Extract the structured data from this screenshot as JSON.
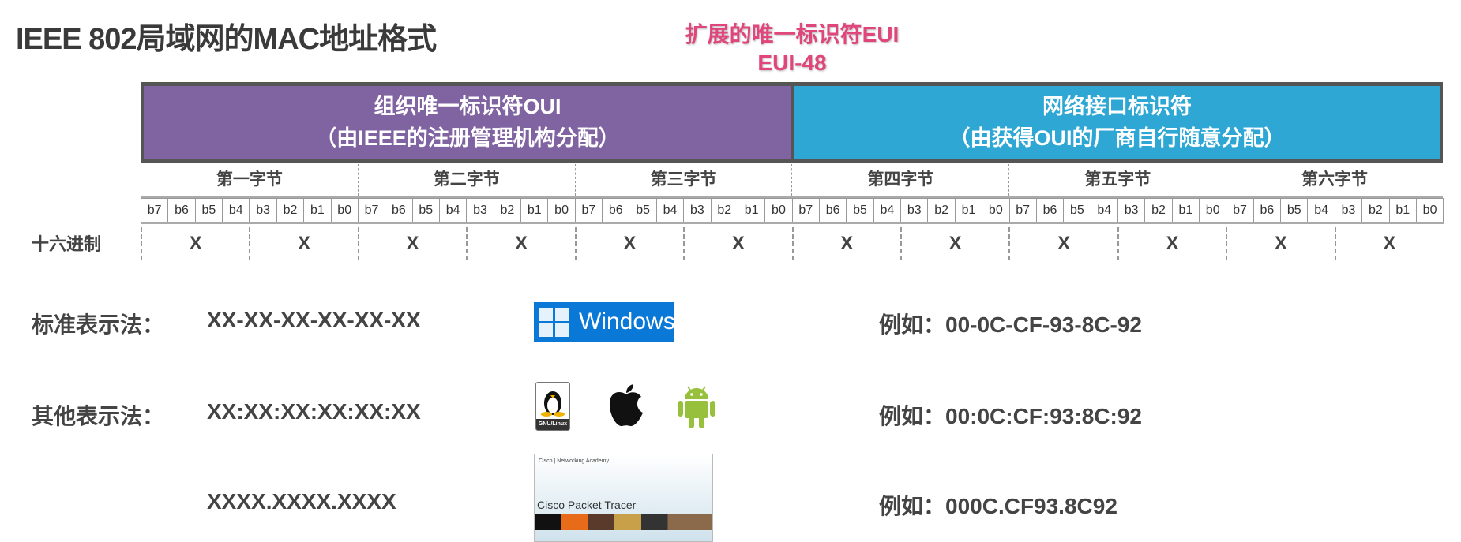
{
  "title": "IEEE 802局域网的MAC地址格式",
  "eui": {
    "line1": "扩展的唯一标识符EUI",
    "line2": "EUI-48"
  },
  "oui": {
    "line1": "组织唯一标识符OUI",
    "line2": "（由IEEE的注册管理机构分配）"
  },
  "nic": {
    "line1": "网络接口标识符",
    "line2": "（由获得OUI的厂商自行随意分配）"
  },
  "bytes": [
    "第一字节",
    "第二字节",
    "第三字节",
    "第四字节",
    "第五字节",
    "第六字节"
  ],
  "bits": [
    "b7",
    "b6",
    "b5",
    "b4",
    "b3",
    "b2",
    "b1",
    "b0"
  ],
  "hex": {
    "label": "十六进制",
    "nibble": "X"
  },
  "rows": [
    {
      "label": "标准表示法：",
      "format": "XX-XX-XX-XX-XX-XX",
      "example": "例如：00-0C-CF-93-8C-92"
    },
    {
      "label": "其他表示法：",
      "format": "XX:XX:XX:XX:XX:XX",
      "example": "例如：00:0C:CF:93:8C:92"
    },
    {
      "label": "",
      "format": "XXXX.XXXX.XXXX",
      "example": "例如：000C.CF93.8C92"
    }
  ],
  "logos": {
    "windows": "Windows",
    "linux": "GNU/Linux",
    "cisco_header": "Cisco | Networking Academy",
    "cisco_title": "Cisco Packet Tracer"
  },
  "colors": {
    "oui": "#8064a2",
    "nic": "#2ea7d4",
    "accent": "#e0457b"
  }
}
